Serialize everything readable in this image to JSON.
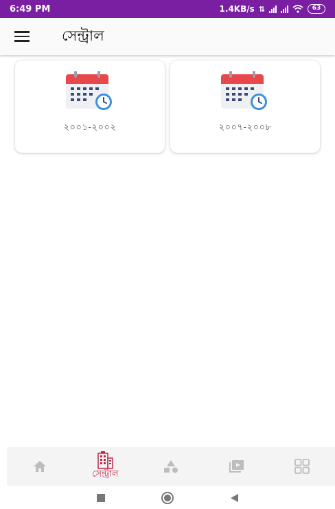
{
  "status_bar": {
    "time": "6:49 PM",
    "speed": "1.4KB/s",
    "battery": "63"
  },
  "app_bar": {
    "title": "সেন্ট্রাল"
  },
  "cards": [
    {
      "label": "২০০১-২০০২",
      "icon": "calendar-clock-icon"
    },
    {
      "label": "২০০৭-২০০৮",
      "icon": "calendar-clock-icon"
    }
  ],
  "bottom_nav": {
    "items": [
      {
        "icon": "home-icon",
        "label": ""
      },
      {
        "icon": "building-icon",
        "label": "সেন্ট্রাল",
        "active": true
      },
      {
        "icon": "shapes-icon",
        "label": ""
      },
      {
        "icon": "video-library-icon",
        "label": ""
      },
      {
        "icon": "grid-icon",
        "label": ""
      }
    ]
  },
  "colors": {
    "status_bar": "#7a1fa2",
    "accent": "#c0284a",
    "calendar_red": "#e8474c",
    "clock_blue": "#3b8fd9"
  }
}
